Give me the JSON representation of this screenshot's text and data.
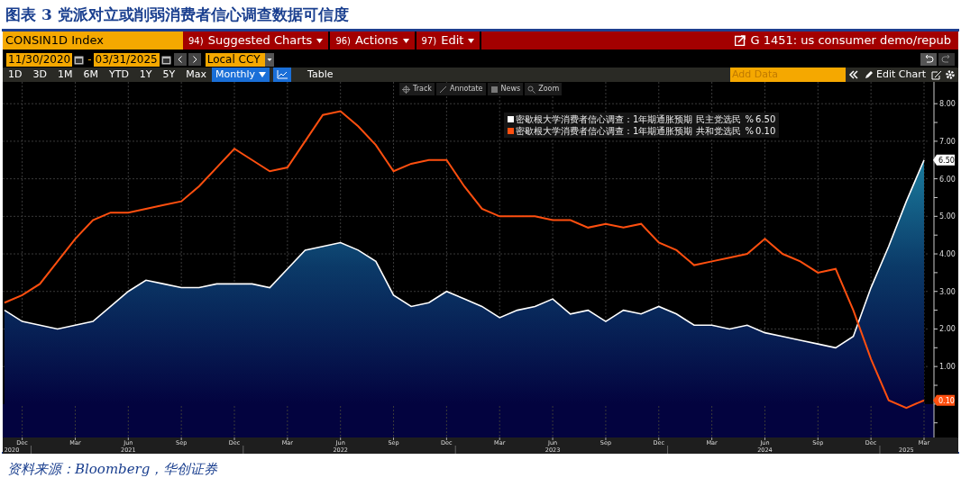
{
  "figure_title": "图表 3 党派对立或削弱消费者信心调查数据可信度",
  "terminal": {
    "ticker": "CONSIN1D Index",
    "menu_buttons": [
      {
        "number": "94)",
        "label": "Suggested Charts"
      },
      {
        "number": "96)",
        "label": "Actions"
      },
      {
        "number": "97)",
        "label": "Edit"
      }
    ],
    "chart_name": "G 1451: us consumer demo/repub",
    "start_date": "11/30/2020",
    "date_separator": "-",
    "end_date": "03/31/2025",
    "currency": "Local CCY",
    "ranges": [
      {
        "label": "1D",
        "selected": false
      },
      {
        "label": "3D",
        "selected": false
      },
      {
        "label": "1M",
        "selected": false
      },
      {
        "label": "6M",
        "selected": false
      },
      {
        "label": "YTD",
        "selected": false
      },
      {
        "label": "1Y",
        "selected": false
      },
      {
        "label": "5Y",
        "selected": false
      },
      {
        "label": "Max",
        "selected": false
      }
    ],
    "periodicity": "Monthly",
    "views": [
      {
        "kind": "chart",
        "selected": true
      },
      {
        "kind": "table",
        "label": "Table",
        "selected": false
      }
    ],
    "add_data": {
      "placeholder": "Add Data"
    },
    "edit_chart": "Edit Chart",
    "chart_tools": [
      {
        "kind": "track",
        "label": "Track"
      },
      {
        "kind": "annotate",
        "label": "Annotate"
      },
      {
        "kind": "news",
        "label": "News"
      },
      {
        "kind": "zoom",
        "label": "Zoom"
      }
    ],
    "legend": [
      {
        "unit": "%",
        "value": "6.50"
      },
      {
        "unit": "%",
        "value": "0.10"
      }
    ],
    "chart_data": {
      "type": "area",
      "grid": true,
      "categories": [
        "\n2020",
        "Dec",
        null,
        null,
        "Mar",
        null,
        null,
        "Jun\n2021",
        null,
        null,
        "Sep",
        null,
        null,
        "Dec",
        null,
        null,
        "Mar",
        null,
        null,
        "Jun\n2022",
        null,
        null,
        "Sep",
        null,
        null,
        "Dec",
        null,
        null,
        "Mar",
        null,
        null,
        "Jun\n2023",
        null,
        null,
        "Sep",
        null,
        null,
        "Dec",
        null,
        null,
        "Mar",
        null,
        null,
        "Jun\n2024",
        null,
        null,
        "Sep",
        null,
        null,
        "Dec",
        null,
        "\n2025",
        "Mar"
      ],
      "series": [
        {
          "name": "密歇根大学消费者信心调查：1年期通胀预期 民主党选民",
          "type": "area",
          "color": "#ffffff",
          "values": [
            2.5,
            2.2,
            2.1,
            2.0,
            2.1,
            2.2,
            2.6,
            3.0,
            3.3,
            3.2,
            3.1,
            3.1,
            3.2,
            3.2,
            3.2,
            3.1,
            3.6,
            4.1,
            4.2,
            4.3,
            4.1,
            3.8,
            2.9,
            2.6,
            2.7,
            3.0,
            2.8,
            2.6,
            2.3,
            2.5,
            2.6,
            2.8,
            2.4,
            2.5,
            2.2,
            2.5,
            2.4,
            2.6,
            2.4,
            2.1,
            2.1,
            2.0,
            2.1,
            1.9,
            1.8,
            1.7,
            1.6,
            1.5,
            1.8,
            3.1,
            4.2,
            5.4,
            6.5
          ]
        },
        {
          "name": "密歇根大学消费者信心调查：1年期通胀预期 共和党选民",
          "type": "line",
          "color": "#ff4f0f",
          "values": [
            2.7,
            2.9,
            3.2,
            3.8,
            4.4,
            4.9,
            5.1,
            5.1,
            5.2,
            5.3,
            5.4,
            5.8,
            6.3,
            6.8,
            6.5,
            6.2,
            6.3,
            7.0,
            7.7,
            7.8,
            7.4,
            6.9,
            6.2,
            6.4,
            6.5,
            6.5,
            5.8,
            5.2,
            5.0,
            5.0,
            5.0,
            4.9,
            4.9,
            4.7,
            4.8,
            4.7,
            4.8,
            4.3,
            4.1,
            3.7,
            3.8,
            3.9,
            4.0,
            4.4,
            4.0,
            3.8,
            3.5,
            3.6,
            2.5,
            1.2,
            0.1,
            -0.1,
            0.1
          ]
        }
      ],
      "ylim": [
        -0.89,
        8.58
      ],
      "yticks": [
        {
          "value": 1,
          "label": "1.00"
        },
        {
          "value": 2,
          "label": "2.00"
        },
        {
          "value": 3,
          "label": "3.00"
        },
        {
          "value": 4,
          "label": "4.00"
        },
        {
          "value": 5,
          "label": "5.00"
        },
        {
          "value": 6,
          "label": "6.00"
        },
        {
          "value": 7,
          "label": "7.00"
        },
        {
          "value": 8,
          "label": "8.00"
        }
      ],
      "annotations": [
        "6.50",
        "0.10"
      ]
    }
  },
  "source": "资料来源：Bloomberg，华创证券"
}
